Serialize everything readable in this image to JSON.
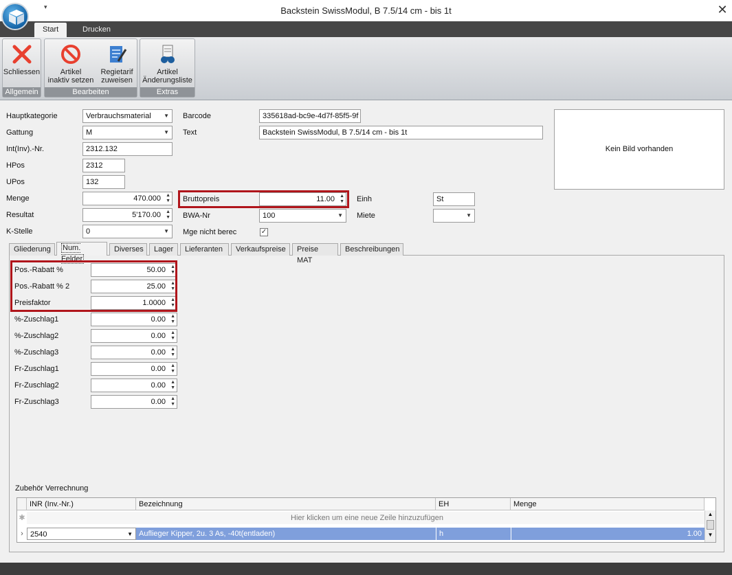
{
  "window": {
    "title": "Backstein SwissModul, B 7.5/14 cm - bis 1t",
    "close_glyph": "✕",
    "qat_glyph": "▾"
  },
  "ribbon": {
    "tabs": [
      "Start",
      "Drucken"
    ],
    "groups": [
      {
        "label": "Allgemein",
        "buttons": [
          {
            "label": "Schliessen",
            "icon": "close-x-icon"
          }
        ]
      },
      {
        "label": "Bearbeiten",
        "buttons": [
          {
            "label": "Artikel\ninaktiv setzen",
            "icon": "no-entry-icon"
          },
          {
            "label": "Regietarif\nzuweisen",
            "icon": "notepad-pen-icon"
          }
        ]
      },
      {
        "label": "Extras",
        "buttons": [
          {
            "label": "Artikel\nÄnderungsliste",
            "icon": "binoculars-document-icon"
          }
        ]
      }
    ]
  },
  "form": {
    "hauptkategorie": {
      "label": "Hauptkategorie",
      "value": "Verbrauchsmaterial"
    },
    "gattung": {
      "label": "Gattung",
      "value": "M"
    },
    "int_nr": {
      "label": "Int(Inv).-Nr.",
      "value": "2312.132"
    },
    "hpos": {
      "label": "HPos",
      "value": "2312"
    },
    "upos": {
      "label": "UPos",
      "value": "132"
    },
    "menge": {
      "label": "Menge",
      "value": "470.000"
    },
    "resultat": {
      "label": "Resultat",
      "value": "5'170.00"
    },
    "kstelle": {
      "label": "K-Stelle",
      "value": "0"
    },
    "barcode": {
      "label": "Barcode",
      "value": "335618ad-bc9e-4d7f-85f5-9f"
    },
    "text": {
      "label": "Text",
      "value": "Backstein SwissModul, B 7.5/14 cm - bis 1t"
    },
    "bruttopreis": {
      "label": "Bruttopreis",
      "value": "11.00"
    },
    "bwa_nr": {
      "label": "BWA-Nr",
      "value": "100"
    },
    "mge_nicht_berec": {
      "label": "Mge nicht berec",
      "checked": true,
      "check_glyph": "✓"
    },
    "einh": {
      "label": "Einh",
      "value": "St"
    },
    "miete": {
      "label": "Miete",
      "value": ""
    },
    "image_placeholder": "Kein Bild vorhanden"
  },
  "detail_tabs": [
    "Gliederung",
    "Num. Felder",
    "Diverses",
    "Lager",
    "Lieferanten",
    "Verkaufspreise",
    "Preise MAT",
    "Beschreibungen"
  ],
  "num_fields": [
    {
      "label": "Pos.-Rabatt %",
      "value": "50.00"
    },
    {
      "label": "Pos.-Rabatt % 2",
      "value": "25.00"
    },
    {
      "label": "Preisfaktor",
      "value": "1.0000"
    },
    {
      "label": "%-Zuschlag1",
      "value": "0.00"
    },
    {
      "label": "%-Zuschlag2",
      "value": "0.00"
    },
    {
      "label": "%-Zuschlag3",
      "value": "0.00"
    },
    {
      "label": "Fr-Zuschlag1",
      "value": "0.00"
    },
    {
      "label": "Fr-Zuschlag2",
      "value": "0.00"
    },
    {
      "label": "Fr-Zuschlag3",
      "value": "0.00"
    }
  ],
  "zubehoer": {
    "title": "Zubehör Verrechnung",
    "columns": [
      "INR (Inv.-Nr.)",
      "Bezeichnung",
      "EH",
      "Menge"
    ],
    "new_row_hint": "Hier klicken um eine neue Zeile hinzuzufügen",
    "rows": [
      {
        "inr": "2540",
        "bezeichnung": "Auflieger Kipper, 2u. 3 As, -40t(entladen)",
        "eh": "h",
        "menge": "1.00"
      }
    ]
  },
  "colors": {
    "accent_red": "#b0151b",
    "selection_blue": "#7f9fdc",
    "ribbon_dark": "#464646"
  }
}
